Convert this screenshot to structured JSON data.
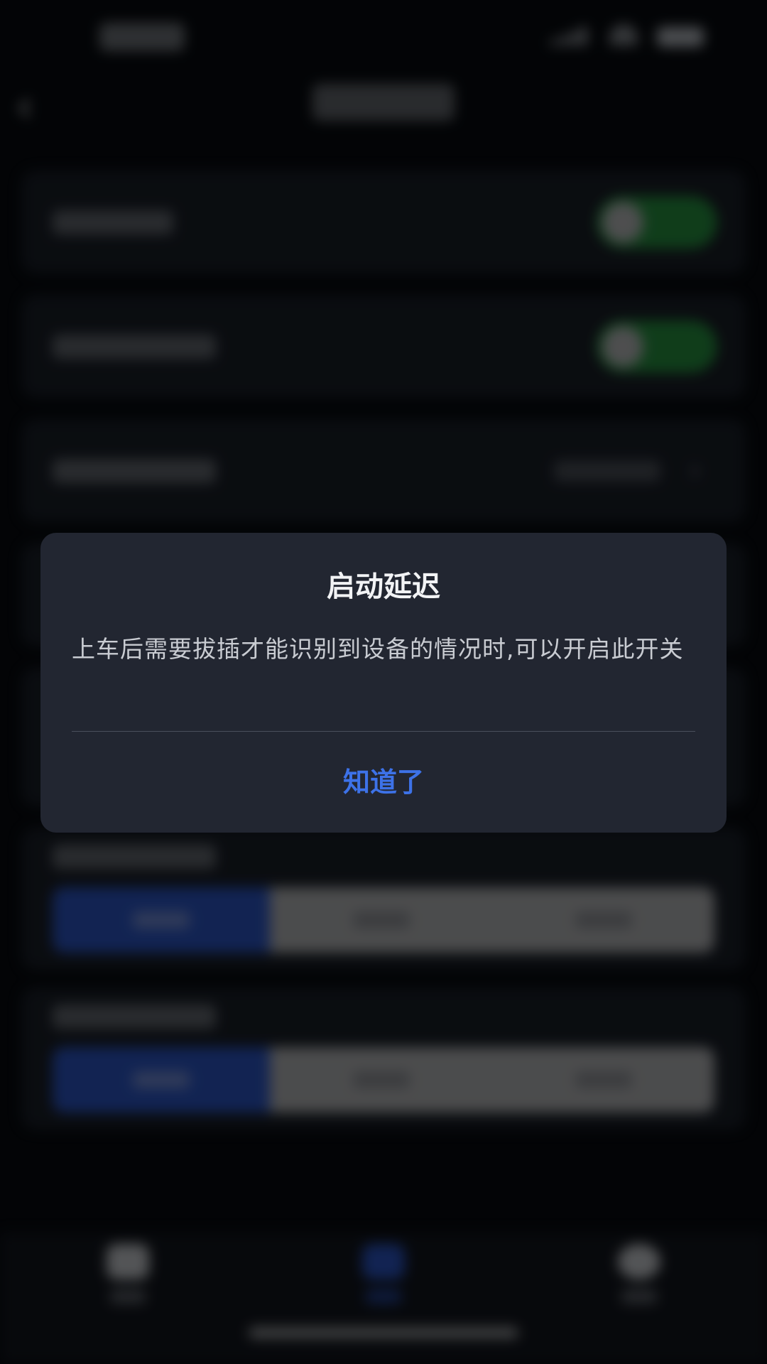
{
  "dialog": {
    "title": "启动延迟",
    "message": "上车后需要拔插才能识别到设备的情况时,可以开启此开关",
    "confirm_label": "知道了"
  },
  "icons": {
    "back": "chevron-left-icon",
    "row_arrow": "chevron-right-icon"
  },
  "background_state": {
    "toggle_1_on": true,
    "toggle_2_on": true,
    "segment_1_selected_index": 0,
    "segment_2_selected_index": 0
  },
  "colors": {
    "dialog_background": "#222631",
    "accent": "#3d72e8",
    "toggle_on": "#2aa644",
    "segment_active": "#2f5fe0"
  }
}
